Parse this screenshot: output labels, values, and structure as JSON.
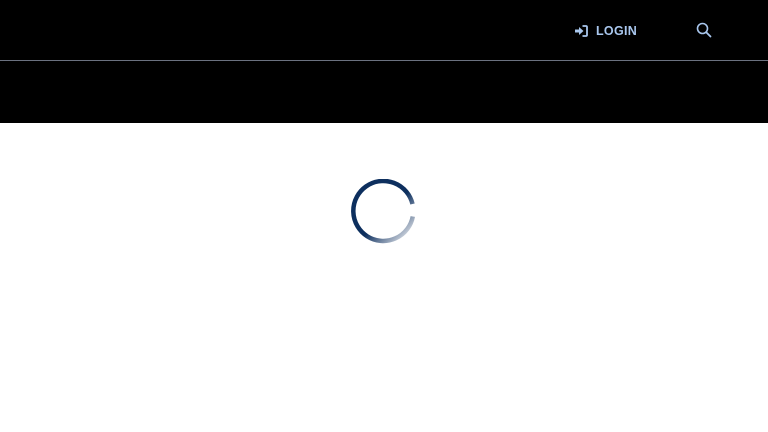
{
  "header": {
    "login_label": "LOGIN",
    "login_icon": "sign-in-icon",
    "search_icon": "search-icon"
  },
  "loading": {
    "indicator": "loading-spinner"
  },
  "colors": {
    "header_bg": "#000000",
    "header_link": "#a9c7ee",
    "divider": "#6b7280",
    "spinner": "#0d2f5e",
    "page_bg": "#ffffff"
  }
}
